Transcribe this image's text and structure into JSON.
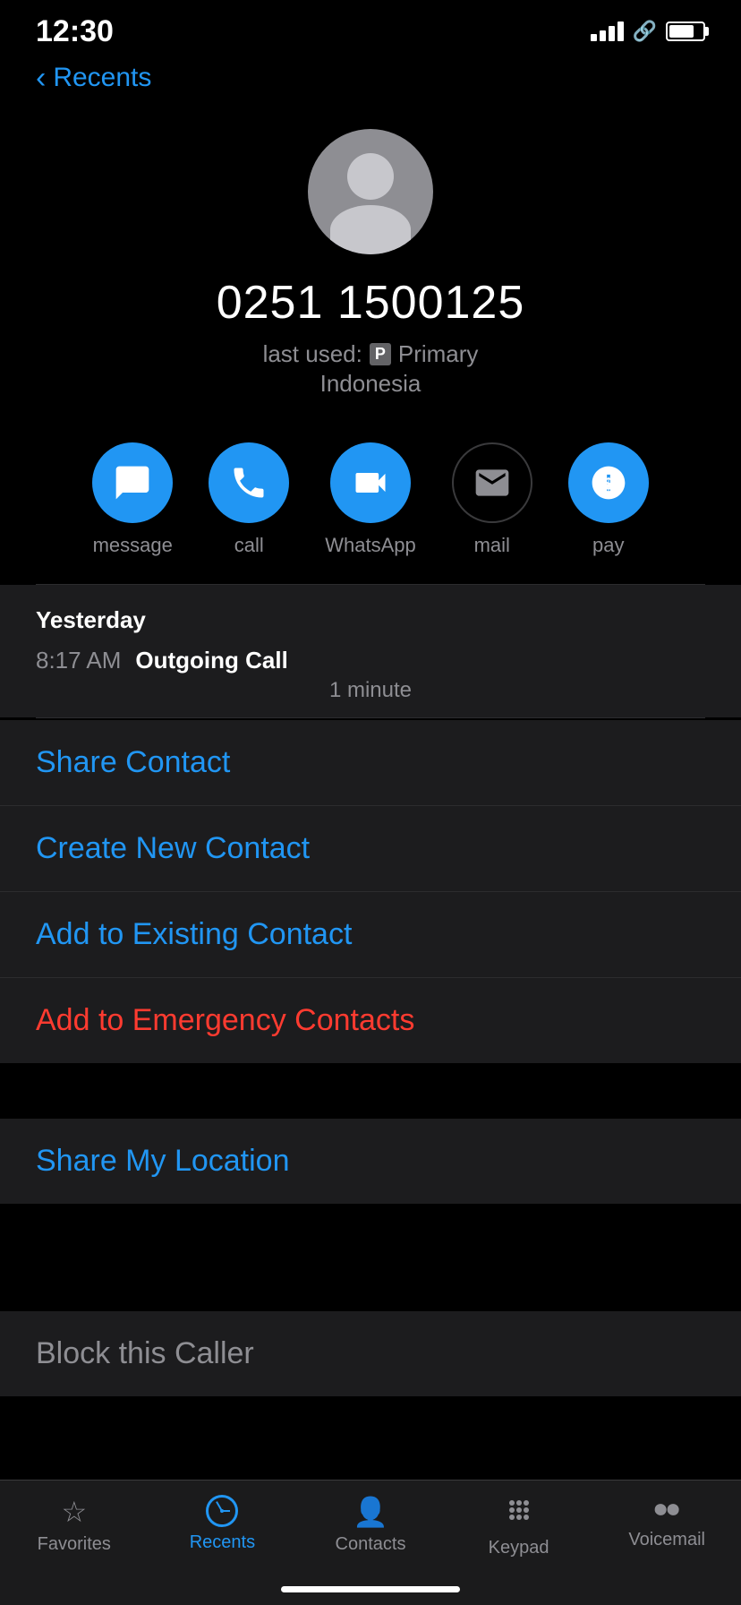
{
  "statusBar": {
    "time": "12:30",
    "batteryLevel": 75
  },
  "header": {
    "backLabel": "Recents"
  },
  "contact": {
    "phoneNumber": "0251 1500125",
    "lastUsedLabel": "last used:",
    "primaryBadge": "P",
    "primaryLabel": "Primary",
    "countryLabel": "Indonesia"
  },
  "actions": [
    {
      "id": "message",
      "label": "message",
      "enabled": true
    },
    {
      "id": "call",
      "label": "call",
      "enabled": true
    },
    {
      "id": "whatsapp",
      "label": "WhatsApp",
      "enabled": true
    },
    {
      "id": "mail",
      "label": "mail",
      "enabled": false
    },
    {
      "id": "pay",
      "label": "pay",
      "enabled": true
    }
  ],
  "callHistory": {
    "dateLabel": "Yesterday",
    "time": "8:17 AM",
    "type": "Outgoing Call",
    "duration": "1 minute"
  },
  "menuItems": [
    {
      "id": "share-contact",
      "label": "Share Contact",
      "color": "blue"
    },
    {
      "id": "create-new-contact",
      "label": "Create New Contact",
      "color": "blue"
    },
    {
      "id": "add-existing-contact",
      "label": "Add to Existing Contact",
      "color": "blue"
    },
    {
      "id": "add-emergency",
      "label": "Add to Emergency Contacts",
      "color": "red"
    }
  ],
  "shareLocation": {
    "label": "Share My Location"
  },
  "blockCaller": {
    "label": "Block this Caller"
  },
  "tabBar": {
    "items": [
      {
        "id": "favorites",
        "label": "Favorites",
        "active": false
      },
      {
        "id": "recents",
        "label": "Recents",
        "active": true
      },
      {
        "id": "contacts",
        "label": "Contacts",
        "active": false
      },
      {
        "id": "keypad",
        "label": "Keypad",
        "active": false
      },
      {
        "id": "voicemail",
        "label": "Voicemail",
        "active": false
      }
    ]
  },
  "colors": {
    "accent": "#2196F3",
    "danger": "#ff3b30",
    "inactive": "#8e8e93",
    "background": "#000",
    "card": "#1c1c1e"
  }
}
